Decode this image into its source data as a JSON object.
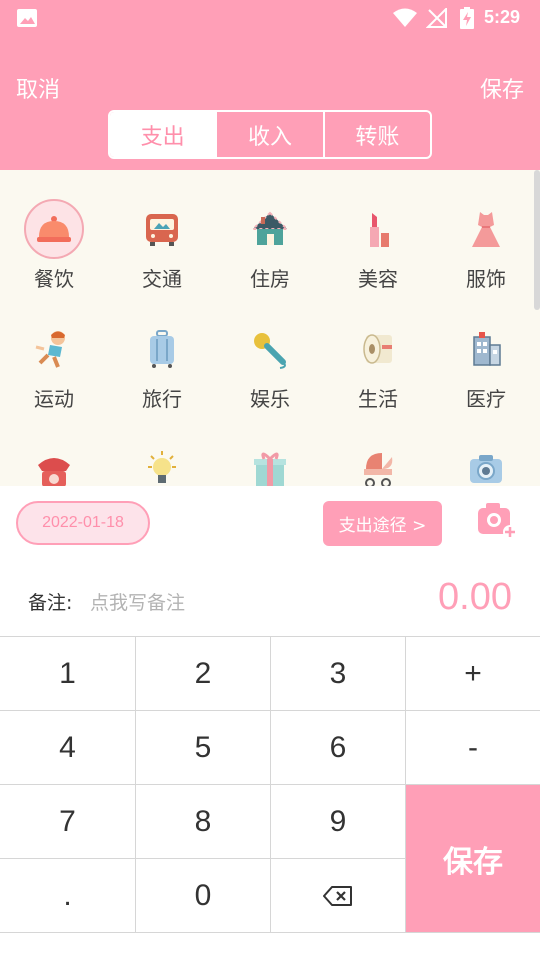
{
  "status_bar": {
    "time": "5:29"
  },
  "header": {
    "cancel_label": "取消",
    "save_label": "保存",
    "tabs": [
      {
        "label": "支出",
        "active": true
      },
      {
        "label": "收入",
        "active": false
      },
      {
        "label": "转账",
        "active": false
      }
    ]
  },
  "categories": [
    {
      "label": "餐饮",
      "icon": "dining-icon",
      "selected": true
    },
    {
      "label": "交通",
      "icon": "bus-icon",
      "selected": false
    },
    {
      "label": "住房",
      "icon": "house-icon",
      "selected": false
    },
    {
      "label": "美容",
      "icon": "lipstick-icon",
      "selected": false
    },
    {
      "label": "服饰",
      "icon": "dress-icon",
      "selected": false
    },
    {
      "label": "运动",
      "icon": "running-icon",
      "selected": false
    },
    {
      "label": "旅行",
      "icon": "suitcase-icon",
      "selected": false
    },
    {
      "label": "娱乐",
      "icon": "microphone-icon",
      "selected": false
    },
    {
      "label": "生活",
      "icon": "tissue-roll-icon",
      "selected": false
    },
    {
      "label": "医疗",
      "icon": "hospital-icon",
      "selected": false
    },
    {
      "icon": "telephone-icon"
    },
    {
      "icon": "lightbulb-icon"
    },
    {
      "icon": "gift-icon"
    },
    {
      "icon": "stroller-icon"
    },
    {
      "icon": "camera-icon"
    }
  ],
  "date": "2022-01-18",
  "purpose_label": "支出途径 >",
  "note": {
    "label": "备注:",
    "placeholder": "点我写备注"
  },
  "amount": "0.00",
  "keypad": {
    "k1": "1",
    "k2": "2",
    "k3": "3",
    "plus": "+",
    "k4": "4",
    "k5": "5",
    "k6": "6",
    "minus": "-",
    "k7": "7",
    "k8": "8",
    "k9": "9",
    "dot": ".",
    "k0": "0",
    "save": "保存"
  },
  "colors": {
    "accent": "#ff9fb7",
    "grid_bg": "#fbf9f0"
  }
}
